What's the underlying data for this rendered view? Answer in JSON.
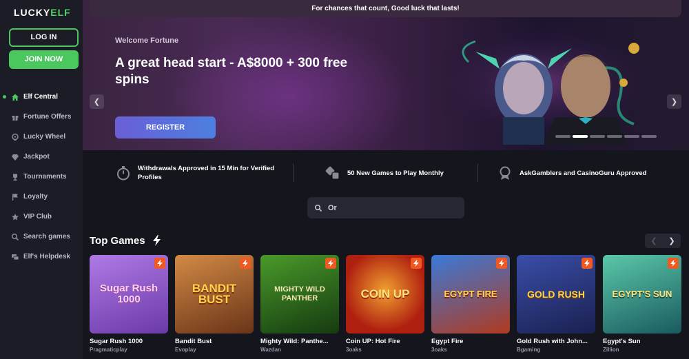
{
  "brand": {
    "logo_text_a": "LUCKY",
    "logo_text_b": "ELF"
  },
  "auth": {
    "login_label": "LOG IN",
    "join_label": "JOIN NOW"
  },
  "sidebar": {
    "items": [
      {
        "label": "Elf Central",
        "icon": "home-icon",
        "active": true
      },
      {
        "label": "Fortune Offers",
        "icon": "gift-icon"
      },
      {
        "label": "Lucky Wheel",
        "icon": "wheel-icon"
      },
      {
        "label": "Jackpot",
        "icon": "diamond-icon"
      },
      {
        "label": "Tournaments",
        "icon": "trophy-icon"
      },
      {
        "label": "Loyalty",
        "icon": "flag-icon"
      },
      {
        "label": "VIP Club",
        "icon": "star-icon"
      },
      {
        "label": "Search games",
        "icon": "search-icon"
      },
      {
        "label": "Elf's Helpdesk",
        "icon": "chat-icon"
      }
    ]
  },
  "topbar": {
    "text": "For chances that count, Good luck that lasts!"
  },
  "hero": {
    "welcome": "Welcome Fortune",
    "headline": "A great head start - A$8000 + 300 free spins",
    "register_label": "REGISTER",
    "slides": 6,
    "active_slide": 2
  },
  "features": [
    {
      "text": "Withdrawals Approved in 15 Min for Verified Profiles",
      "icon": "stopwatch-icon"
    },
    {
      "text": "50 New Games to Play Monthly",
      "icon": "dice-icon"
    },
    {
      "text": "AskGamblers and CasinoGuru Approved",
      "icon": "award-icon"
    }
  ],
  "search": {
    "value": "Or"
  },
  "top_games": {
    "title": "Top Games",
    "games": [
      {
        "name": "Sugar Rush 1000",
        "provider": "Pragmaticplay",
        "art": "Sugar Rush 1000",
        "bg": "#9b5fd6"
      },
      {
        "name": "Bandit Bust",
        "provider": "Evoplay",
        "art": "BANDIT BUST",
        "bg": "#b5632c"
      },
      {
        "name": "Mighty Wild: Panthe...",
        "provider": "Wazdan",
        "art": "MIGHTY WILD PANTHER",
        "bg": "#2f6a1f"
      },
      {
        "name": "Coin UP: Hot Fire",
        "provider": "3oaks",
        "art": "COIN UP",
        "bg": "#c9341e"
      },
      {
        "name": "Egypt Fire",
        "provider": "3oaks",
        "art": "EGYPT FIRE",
        "bg": "#2a64b8"
      },
      {
        "name": "Gold Rush with John...",
        "provider": "Bgaming",
        "art": "GOLD RUSH",
        "bg": "#2b3d8c"
      },
      {
        "name": "Egypt's Sun",
        "provider": "Zillion",
        "art": "EGYPT'S SUN",
        "bg": "#2f9a7e"
      }
    ]
  }
}
